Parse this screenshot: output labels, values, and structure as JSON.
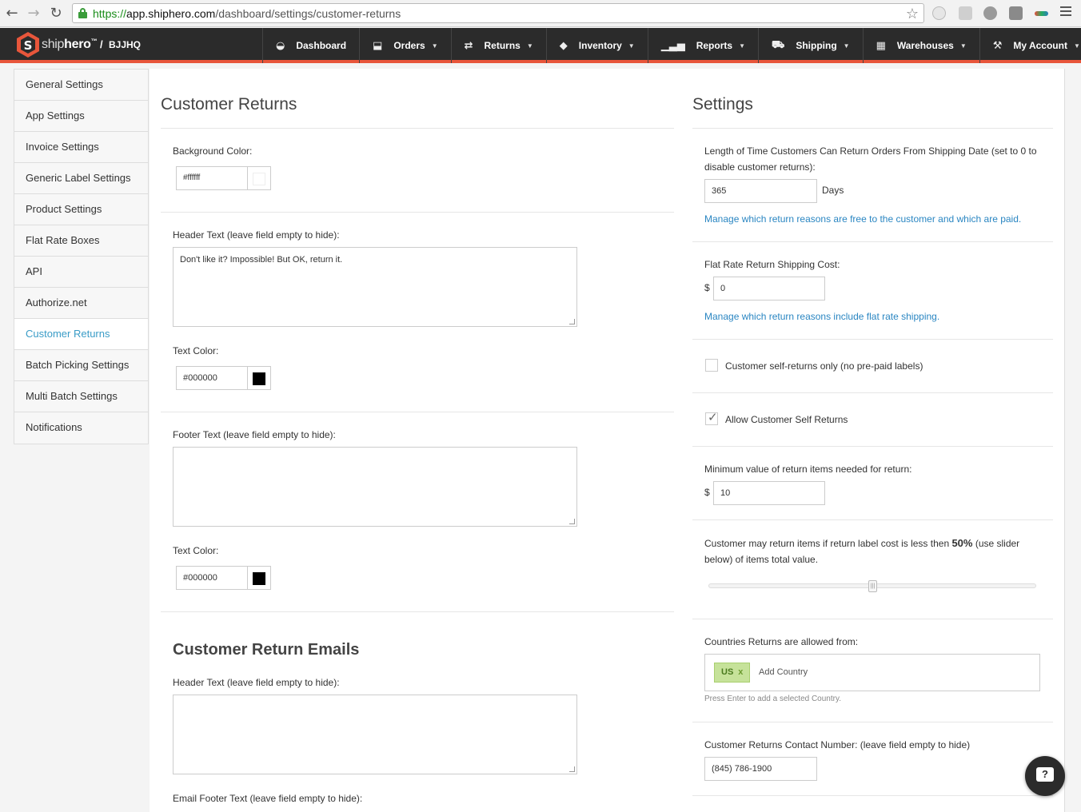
{
  "browser": {
    "url_scheme": "https://",
    "url_host": "app.shiphero.com",
    "url_path": "/dashboard/settings/customer-returns"
  },
  "header": {
    "brand_bold": "ship",
    "brand_light": "hero",
    "brand_tm": "™",
    "separator": "/",
    "account": "BJJHQ",
    "nav": [
      {
        "label": "Dashboard",
        "icon": "dashboard-icon",
        "glyph": "◒",
        "caret": false
      },
      {
        "label": "Orders",
        "icon": "inbox-icon",
        "glyph": "⬓",
        "caret": true
      },
      {
        "label": "Returns",
        "icon": "exchange-icon",
        "glyph": "⇄",
        "caret": true
      },
      {
        "label": "Inventory",
        "icon": "tags-icon",
        "glyph": "◆",
        "caret": true
      },
      {
        "label": "Reports",
        "icon": "signal-icon",
        "glyph": "▁▃▅",
        "caret": true
      },
      {
        "label": "Shipping",
        "icon": "truck-icon",
        "glyph": "⛟",
        "caret": true
      },
      {
        "label": "Warehouses",
        "icon": "building-icon",
        "glyph": "▦",
        "caret": true
      },
      {
        "label": "My Account",
        "icon": "wrench-icon",
        "glyph": "⚒",
        "caret": true
      }
    ],
    "accent_color": "#e8563b"
  },
  "sidebar": {
    "items": [
      {
        "label": "General Settings",
        "active": false
      },
      {
        "label": "App Settings",
        "active": false
      },
      {
        "label": "Invoice Settings",
        "active": false
      },
      {
        "label": "Generic Label Settings",
        "active": false
      },
      {
        "label": "Product Settings",
        "active": false
      },
      {
        "label": "Flat Rate Boxes",
        "active": false
      },
      {
        "label": "API",
        "active": false
      },
      {
        "label": "Authorize.net",
        "active": false
      },
      {
        "label": "Customer Returns",
        "active": true
      },
      {
        "label": "Batch Picking Settings",
        "active": false
      },
      {
        "label": "Multi Batch Settings",
        "active": false
      },
      {
        "label": "Notifications",
        "active": false
      }
    ]
  },
  "left": {
    "title": "Customer Returns",
    "bg_color_label": "Background Color:",
    "bg_color_value": "#ffffff",
    "bg_swatch": "#ffffff",
    "header_text_label": "Header Text (leave field empty to hide):",
    "header_text_value": "Don't like it? Impossible! But OK, return it.",
    "header_color_label": "Text Color:",
    "header_color_value": "#000000",
    "header_swatch": "#000000",
    "footer_text_label": "Footer Text (leave field empty to hide):",
    "footer_text_value": "",
    "footer_color_label": "Text Color:",
    "footer_color_value": "#000000",
    "footer_swatch": "#000000",
    "emails_title": "Customer Return Emails",
    "email_header_label": "Header Text (leave field empty to hide):",
    "email_header_value": "",
    "email_footer_label": "Email Footer Text (leave field empty to hide):"
  },
  "right": {
    "title": "Settings",
    "return_window_label": "Length of Time Customers Can Return Orders From Shipping Date (set to 0 to disable customer returns):",
    "return_window_value": "365",
    "return_window_unit": "Days",
    "reasons_link": "Manage which return reasons are free to the customer and which are paid.",
    "flat_rate_label": "Flat Rate Return Shipping Cost:",
    "currency": "$",
    "flat_rate_value": "0",
    "flat_rate_link": "Manage which return reasons include flat rate shipping.",
    "self_returns_only_label": "Customer self-returns only (no pre-paid labels)",
    "self_returns_only_checked": false,
    "allow_self_returns_label": "Allow Customer Self Returns",
    "allow_self_returns_checked": true,
    "min_value_label": "Minimum value of return items needed for return:",
    "min_value": "10",
    "slider_text_before": "Customer may return items if return label cost is less then ",
    "slider_percent": "50%",
    "slider_text_after": " (use slider below) of items total value.",
    "slider_fraction": 0.5,
    "countries_label": "Countries Returns are allowed from:",
    "country_tag": "US",
    "country_tag_remove": "x",
    "add_country_placeholder": "Add Country",
    "countries_help": "Press Enter to add a selected Country.",
    "contact_label": "Customer Returns Contact Number: (leave field empty to hide)",
    "contact_value": "(845) 786-1900"
  },
  "chat": {
    "glyph": "?"
  }
}
